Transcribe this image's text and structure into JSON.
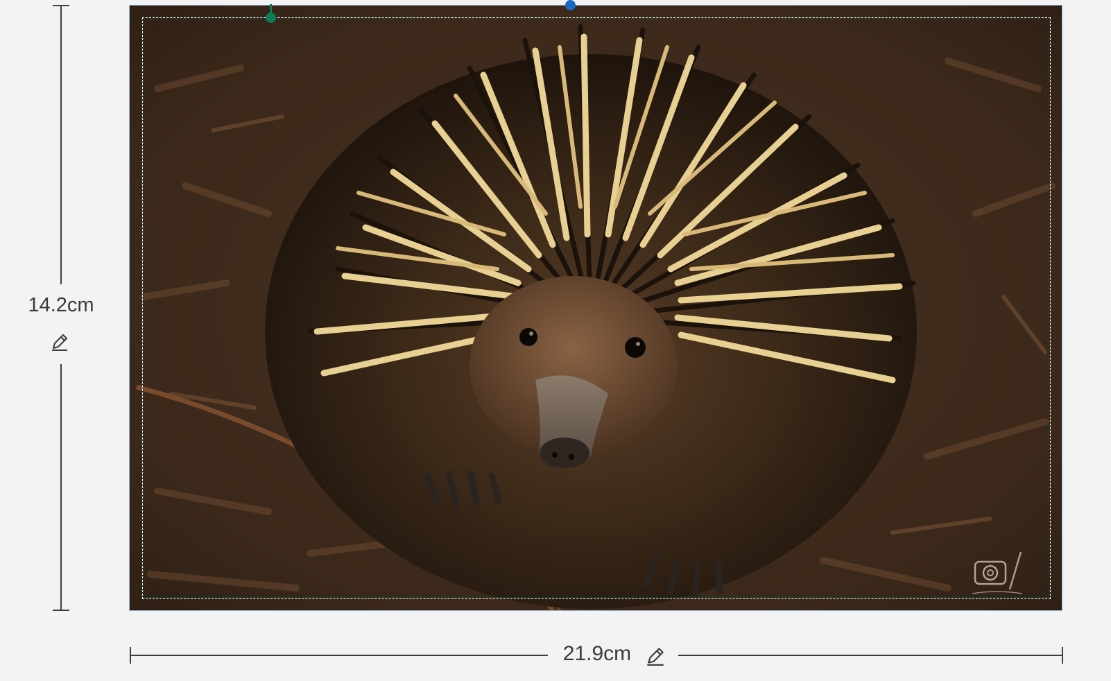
{
  "dimensions": {
    "height_label": "14.2cm",
    "width_label": "21.9cm"
  },
  "icons": {
    "edit": "pencil-icon",
    "rotate_handle": "rotate-handle",
    "anchor_handle": "anchor-handle"
  },
  "colors": {
    "selection_border": "#9ab8d8",
    "rotate_handle": "#1769c4",
    "anchor_handle": "#0f7a5a",
    "safe_area": "#ffffff",
    "dimension_line": "#3d3d3d",
    "background": "#f3f3f3"
  },
  "image": {
    "subject": "echidna-photo"
  }
}
